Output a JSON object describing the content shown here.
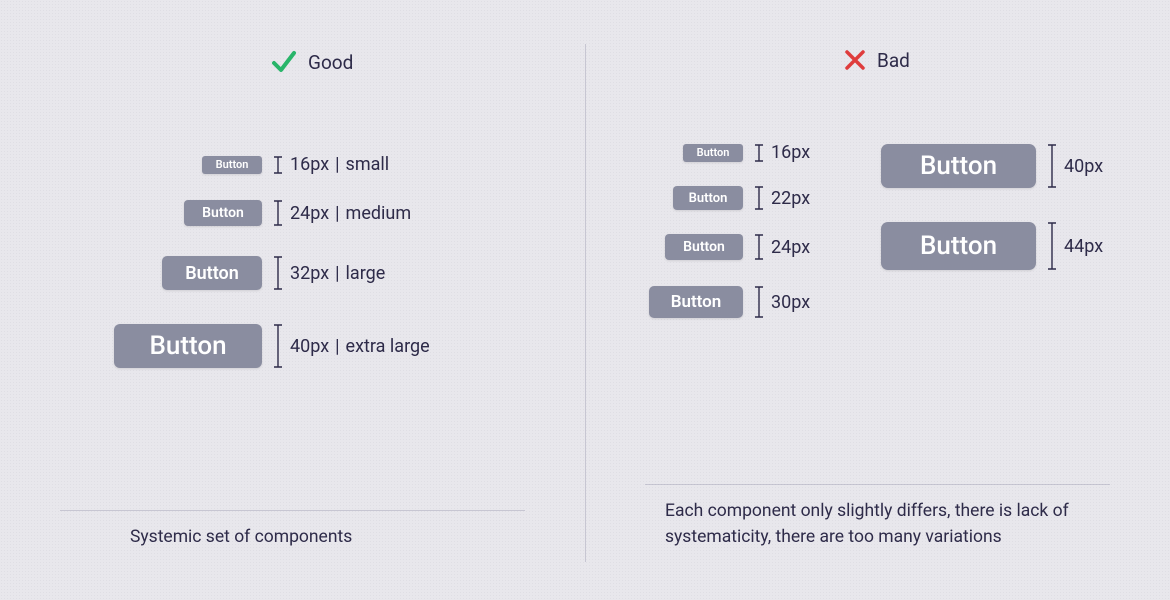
{
  "good": {
    "heading": "Good",
    "caption": "Systemic set of components",
    "buttons": [
      {
        "label": "Button",
        "px": "16px",
        "size_name": "small"
      },
      {
        "label": "Button",
        "px": "24px",
        "size_name": "medium"
      },
      {
        "label": "Button",
        "px": "32px",
        "size_name": "large"
      },
      {
        "label": "Button",
        "px": "40px",
        "size_name": "extra large"
      }
    ]
  },
  "bad": {
    "heading": "Bad",
    "caption": "Each component only slightly differs, there is lack of systematicity, there are too many variations",
    "left_buttons": [
      {
        "label": "Button",
        "px": "16px"
      },
      {
        "label": "Button",
        "px": "22px"
      },
      {
        "label": "Button",
        "px": "24px"
      },
      {
        "label": "Button",
        "px": "30px"
      }
    ],
    "right_buttons": [
      {
        "label": "Button",
        "px": "40px"
      },
      {
        "label": "Button",
        "px": "44px"
      }
    ]
  },
  "colors": {
    "bg": "#e8e7ec",
    "text": "#2e2b49",
    "button": "#8a8da0",
    "check": "#29b56a",
    "cross": "#df3c3c"
  }
}
